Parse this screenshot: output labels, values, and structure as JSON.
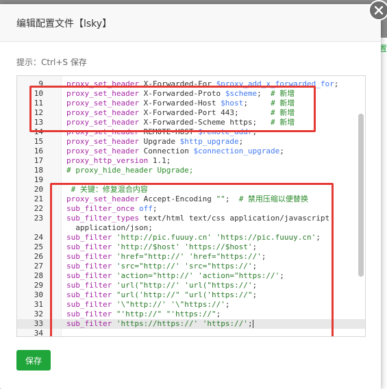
{
  "dialog": {
    "title": "编辑配置文件【lsky】",
    "tip": "提示：Ctrl+S 保存",
    "save_label": "保存"
  },
  "background": {
    "right_text": "置"
  },
  "editor": {
    "lines": [
      {
        "n": "9",
        "segs": [
          [
            "proxy_set_header",
            "k"
          ],
          [
            " X-Forwarded-For ",
            ""
          ],
          [
            "$proxy_add_x_forwarded_for",
            "v"
          ],
          [
            ";",
            ""
          ]
        ]
      },
      {
        "n": "10",
        "segs": [
          [
            "proxy_set_header",
            "k"
          ],
          [
            " X-Forwarded-Proto ",
            ""
          ],
          [
            "$scheme",
            "v"
          ],
          [
            ";  ",
            ""
          ],
          [
            "# 新增",
            "c"
          ]
        ]
      },
      {
        "n": "11",
        "segs": [
          [
            "proxy_set_header",
            "k"
          ],
          [
            " X-Forwarded-Host ",
            ""
          ],
          [
            "$host",
            "v"
          ],
          [
            ";     ",
            ""
          ],
          [
            "# 新增",
            "c"
          ]
        ]
      },
      {
        "n": "12",
        "segs": [
          [
            "proxy_set_header",
            "k"
          ],
          [
            " X-Forwarded-Port 443;       ",
            ""
          ],
          [
            "# 新增",
            "c"
          ]
        ]
      },
      {
        "n": "13",
        "segs": [
          [
            "proxy_set_header",
            "k"
          ],
          [
            " X-Forwarded-Scheme https;   ",
            ""
          ],
          [
            "# 新增",
            "c"
          ]
        ]
      },
      {
        "n": "14",
        "segs": [
          [
            "proxy_set_header",
            "k"
          ],
          [
            " REMOTE-HOST ",
            ""
          ],
          [
            "$remote_addr",
            "v"
          ],
          [
            ";",
            ""
          ]
        ]
      },
      {
        "n": "15",
        "segs": [
          [
            "proxy_set_header",
            "k"
          ],
          [
            " Upgrade ",
            ""
          ],
          [
            "$http_upgrade",
            "v"
          ],
          [
            ";",
            ""
          ]
        ]
      },
      {
        "n": "16",
        "segs": [
          [
            "proxy_set_header",
            "k"
          ],
          [
            " Connection ",
            ""
          ],
          [
            "$connection_upgrade",
            "v"
          ],
          [
            ";",
            ""
          ]
        ]
      },
      {
        "n": "17",
        "segs": [
          [
            "proxy_http_version",
            "k"
          ],
          [
            " 1.1;",
            ""
          ]
        ]
      },
      {
        "n": "18",
        "segs": [
          [
            "# proxy_hide_header Upgrade;",
            "c"
          ]
        ]
      },
      {
        "n": "19",
        "segs": []
      },
      {
        "n": "20",
        "segs": [
          [
            " # 关键：修复混合内容",
            "c"
          ]
        ]
      },
      {
        "n": "21",
        "segs": [
          [
            "proxy_set_header",
            "k"
          ],
          [
            " Accept-Encoding ",
            ""
          ],
          [
            "\"\"",
            "s"
          ],
          [
            ";  ",
            ""
          ],
          [
            "# 禁用压缩以便替换",
            "c"
          ]
        ]
      },
      {
        "n": "22",
        "segs": [
          [
            "sub_filter_once",
            "k"
          ],
          [
            " ",
            ""
          ],
          [
            "off",
            "v"
          ],
          [
            ";",
            ""
          ]
        ]
      },
      {
        "n": "23",
        "segs": [
          [
            "sub_filter_types",
            "k"
          ],
          [
            " text/html text/css application/javascript",
            ""
          ]
        ]
      },
      {
        "n": "",
        "segs": [
          [
            "  application/json;",
            ""
          ]
        ]
      },
      {
        "n": "24",
        "segs": [
          [
            "sub_filter",
            "k"
          ],
          [
            " ",
            ""
          ],
          [
            "'http://pic.fuuuy.cn'",
            "s"
          ],
          [
            " ",
            ""
          ],
          [
            "'https://pic.fuuuy.cn'",
            "s"
          ],
          [
            ";",
            ""
          ]
        ]
      },
      {
        "n": "25",
        "segs": [
          [
            "sub_filter",
            "k"
          ],
          [
            " ",
            ""
          ],
          [
            "'http://$host'",
            "s"
          ],
          [
            " ",
            ""
          ],
          [
            "'https://$host'",
            "s"
          ],
          [
            ";",
            ""
          ]
        ]
      },
      {
        "n": "26",
        "segs": [
          [
            "sub_filter",
            "k"
          ],
          [
            " ",
            ""
          ],
          [
            "'href=\"http://'",
            "s"
          ],
          [
            " ",
            ""
          ],
          [
            "'href=\"https://'",
            "s"
          ],
          [
            ";",
            ""
          ]
        ]
      },
      {
        "n": "27",
        "segs": [
          [
            "sub_filter",
            "k"
          ],
          [
            " ",
            ""
          ],
          [
            "'src=\"http://'",
            "s"
          ],
          [
            " ",
            ""
          ],
          [
            "'src=\"https://'",
            "s"
          ],
          [
            ";",
            ""
          ]
        ]
      },
      {
        "n": "28",
        "segs": [
          [
            "sub_filter",
            "k"
          ],
          [
            " ",
            ""
          ],
          [
            "'action=\"http://'",
            "s"
          ],
          [
            " ",
            ""
          ],
          [
            "'action=\"https://'",
            "s"
          ],
          [
            ";",
            ""
          ]
        ]
      },
      {
        "n": "29",
        "segs": [
          [
            "sub_filter",
            "k"
          ],
          [
            " ",
            ""
          ],
          [
            "'url(\"http://'",
            "s"
          ],
          [
            " ",
            ""
          ],
          [
            "'url(\"https://'",
            "s"
          ],
          [
            ";",
            ""
          ]
        ]
      },
      {
        "n": "30",
        "segs": [
          [
            "sub_filter",
            "k"
          ],
          [
            " ",
            ""
          ],
          [
            "\"url('http://\"",
            "s"
          ],
          [
            " ",
            ""
          ],
          [
            "\"url('https://\"",
            "s"
          ],
          [
            ";",
            ""
          ]
        ]
      },
      {
        "n": "31",
        "segs": [
          [
            "sub_filter",
            "k"
          ],
          [
            " ",
            ""
          ],
          [
            "'\\\"http://'",
            "s"
          ],
          [
            " ",
            ""
          ],
          [
            "'\\\"https://'",
            "s"
          ],
          [
            ";",
            ""
          ]
        ]
      },
      {
        "n": "32",
        "segs": [
          [
            "sub_filter",
            "k"
          ],
          [
            " ",
            ""
          ],
          [
            "\"'http://\"",
            "s"
          ],
          [
            " ",
            ""
          ],
          [
            "\"'https://\"",
            "s"
          ],
          [
            ";",
            ""
          ]
        ]
      },
      {
        "n": "33",
        "segs": [
          [
            "sub_filter",
            "k"
          ],
          [
            " ",
            ""
          ],
          [
            "'https://https://'",
            "s"
          ],
          [
            " ",
            ""
          ],
          [
            "'https://'",
            "s"
          ],
          [
            ";",
            ""
          ]
        ],
        "active": true
      },
      {
        "n": "34",
        "segs": []
      }
    ]
  }
}
